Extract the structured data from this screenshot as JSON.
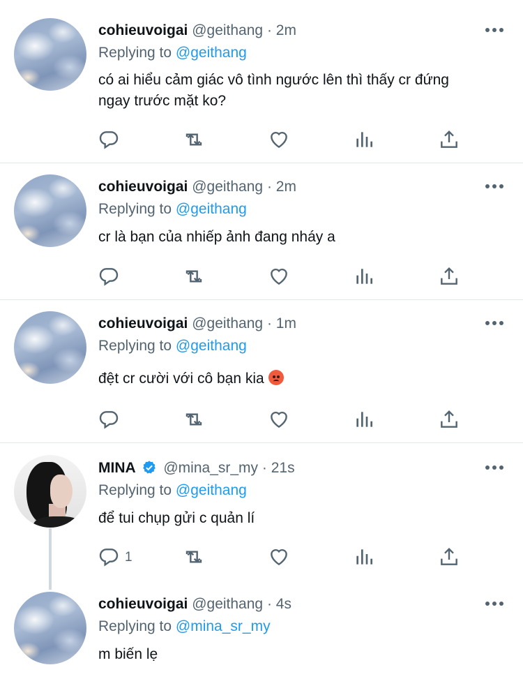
{
  "tweets": [
    {
      "name": "cohieuvoigai",
      "handle": "@geithang",
      "time": "· 2m",
      "replying_prefix": "Replying to",
      "replying_to": "@geithang",
      "text_line1": "có ai hiểu cảm giác vô tình ngước lên thì thấy cr đứng",
      "text_line2": "ngay trước mặt ko?"
    },
    {
      "name": "cohieuvoigai",
      "handle": "@geithang",
      "time": "· 2m",
      "replying_prefix": "Replying to",
      "replying_to": "@geithang",
      "text_line1": "cr là bạn của nhiếp ảnh đang nháy a"
    },
    {
      "name": "cohieuvoigai",
      "handle": "@geithang",
      "time": "· 1m",
      "replying_prefix": "Replying to",
      "replying_to": "@geithang",
      "text_line1": "đệt cr cười với cô bạn kia",
      "emoji": "angry-face"
    },
    {
      "name": "MINA",
      "verified": true,
      "handle": "@mina_sr_my",
      "time": "· 21s",
      "replying_prefix": "Replying to",
      "replying_to": "@geithang",
      "text_line1": "để tui chụp gửi c quản lí",
      "reply_count": "1"
    },
    {
      "name": "cohieuvoigai",
      "handle": "@geithang",
      "time": "· 4s",
      "replying_prefix": "Replying to",
      "replying_to": "@mina_sr_my",
      "text_line1": "m biến lẹ"
    }
  ],
  "colors": {
    "link": "#1d9bf0",
    "muted": "#536471",
    "text": "#0f1419",
    "divider": "#e1e8ed"
  },
  "icons": [
    "reply-icon",
    "retweet-icon",
    "like-icon",
    "views-icon",
    "share-icon",
    "more-icon",
    "verified-icon"
  ]
}
